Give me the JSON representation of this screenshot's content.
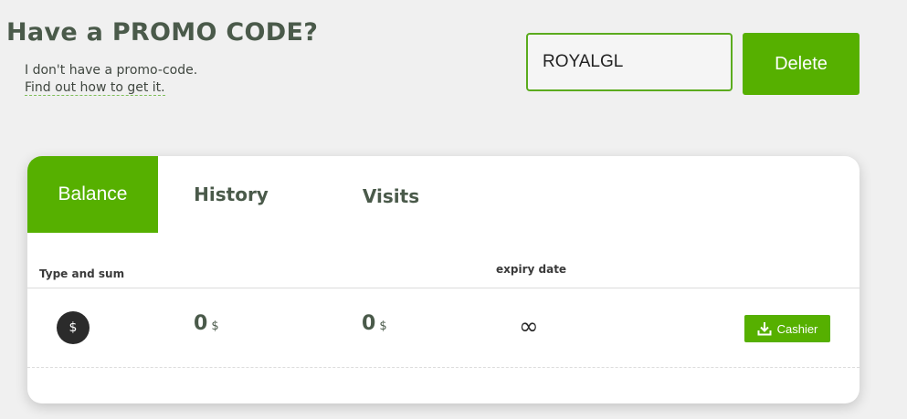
{
  "promo": {
    "title": "Have a PROMO CODE?",
    "note": "I don't have a promo-code.",
    "link": "Find out how to get it.",
    "code_value": "ROYALGL",
    "delete_label": "Delete"
  },
  "tabs": [
    {
      "label": "Balance",
      "active": true
    },
    {
      "label": "History",
      "active": false
    },
    {
      "label": "Visits",
      "active": false
    }
  ],
  "table": {
    "headers": {
      "type_and_sum": "Type and sum",
      "expiry_date": "expiry date"
    },
    "row": {
      "icon": "dollar-icon",
      "icon_glyph": "$",
      "amount1": "0",
      "currency1": "$",
      "amount2": "0",
      "currency2": "$",
      "expiry": "∞",
      "cashier_label": "Cashier"
    }
  },
  "colors": {
    "accent": "#56b000",
    "heading": "#4a5a4a",
    "background": "#f0f0f0"
  }
}
